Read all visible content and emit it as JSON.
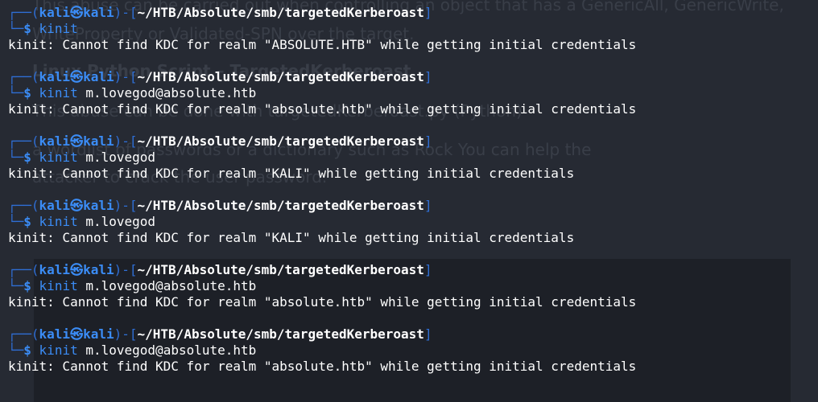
{
  "background_page": {
    "lines": [
      "This abuse can be carried out when controlling an object that has a GenericAll, GenericWrite,",
      "WriteProperty or Validated-SPN over the target.",
      "Linux Python Script – TargetedKerberoast",
      "This abuse can be done with targetedKerberoast.py (Python)",
      "a wordlist of passwords or a dictionary such as Rock You can help the",
      "attacker to crack the user password."
    ]
  },
  "prompt": {
    "open": "┌──(",
    "user": "kali",
    "at": "㉿",
    "host": "kali",
    "mid": ")-[",
    "path": "~/HTB/Absolute/smb/targetedKerberoast",
    "close": "]",
    "second_prefix": "└─",
    "dollar": "$"
  },
  "sessions": [
    {
      "cmd": "kinit",
      "arg": "",
      "output": "kinit: Cannot find KDC for realm \"ABSOLUTE.HTB\" while getting initial credentials"
    },
    {
      "cmd": "kinit",
      "arg": "m.lovegod@absolute.htb",
      "output": "kinit: Cannot find KDC for realm \"absolute.htb\" while getting initial credentials"
    },
    {
      "cmd": "kinit",
      "arg": "m.lovegod",
      "output": "kinit: Cannot find KDC for realm \"KALI\" while getting initial credentials"
    },
    {
      "cmd": "kinit",
      "arg": "m.lovegod",
      "output": "kinit: Cannot find KDC for realm \"KALI\" while getting initial credentials"
    },
    {
      "cmd": "kinit",
      "arg": "m.lovegod@absolute.htb",
      "output": "kinit: Cannot find KDC for realm \"absolute.htb\" while getting initial credentials"
    },
    {
      "cmd": "kinit",
      "arg": "m.lovegod@absolute.htb",
      "output": "kinit: Cannot find KDC for realm \"absolute.htb\" while getting initial credentials"
    }
  ],
  "colors": {
    "background": "#262a33",
    "prompt_blue": "#3b8cf5",
    "text_white": "#ffffff"
  }
}
